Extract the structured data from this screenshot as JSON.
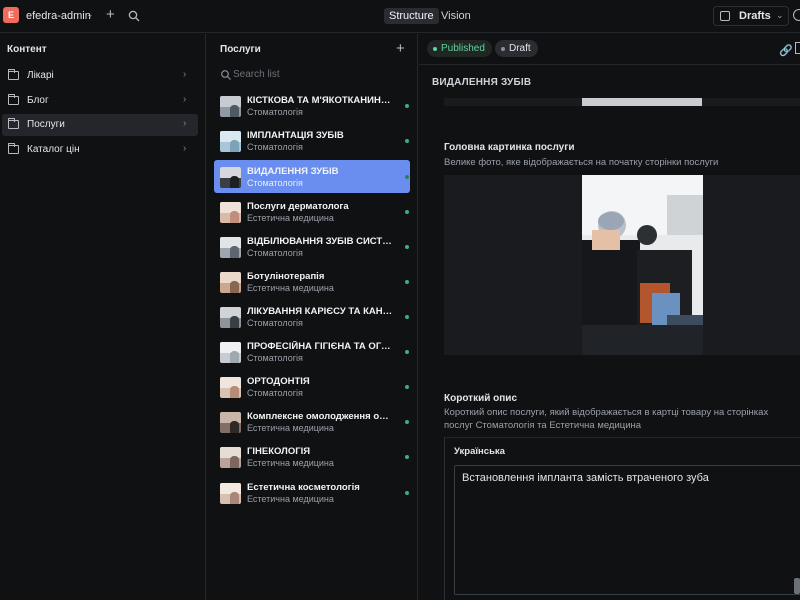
{
  "topbar": {
    "project_initial": "E",
    "project_name": "efedra-admin",
    "tabs": [
      "Structure",
      "Vision"
    ],
    "drafts_label": "Drafts"
  },
  "content_pane": {
    "title": "Контент",
    "items": [
      {
        "label": "Лікарі"
      },
      {
        "label": "Блог"
      },
      {
        "label": "Послуги",
        "selected": true
      },
      {
        "label": "Каталог цін"
      }
    ]
  },
  "list_pane": {
    "title": "Послуги",
    "search_placeholder": "Search list",
    "rows": [
      {
        "title": "КІСТКОВА ТА М'ЯКОТКАНИННА ПЛАСТИКА",
        "subtitle": "Стоматологія"
      },
      {
        "title": "ІМПЛАНТАЦІЯ ЗУБІВ",
        "subtitle": "Стоматологія"
      },
      {
        "title": "ВИДАЛЕННЯ ЗУБІВ",
        "subtitle": "Стоматологія",
        "selected": true
      },
      {
        "title": "Послуги дерматолога",
        "subtitle": "Естетична медицина"
      },
      {
        "title": "ВІДБІЛЮВАННЯ ЗУБІВ СИСТЕМОЮ",
        "subtitle": "Стоматологія"
      },
      {
        "title": "Ботулінотерапія",
        "subtitle": "Естетична медицина"
      },
      {
        "title": "ЛІКУВАННЯ КАРІЄСУ ТА КАНАЛІВ",
        "subtitle": "Стоматологія"
      },
      {
        "title": "ПРОФЕСІЙНА ГІГІЄНА ТА ОГЛЯД",
        "subtitle": "Стоматологія"
      },
      {
        "title": "ОРТОДОНТІЯ",
        "subtitle": "Стоматологія"
      },
      {
        "title": "Комплексне омолодження обличчя",
        "subtitle": "Естетична медицина"
      },
      {
        "title": "ГІНЕКОЛОГІЯ",
        "subtitle": "Естетична медицина"
      },
      {
        "title": "Естетична косметологія",
        "subtitle": "Естетична медицина"
      }
    ]
  },
  "document": {
    "status_published": "Published",
    "status_draft": "Draft",
    "title": "ВИДАЛЕННЯ ЗУБІВ",
    "main_image": {
      "label": "Головна картинка послуги",
      "description": "Велике фото, яке відображається на початку сторінки послуги"
    },
    "short_description": {
      "label": "Короткий опис",
      "description": "Короткий опис послуги, який відображається в картці товару на сторінках послуг Стоматологія та Естетична медицина",
      "language": "Українська",
      "value": "Встановлення імпланта замість втраченого зуба"
    }
  },
  "colors": {
    "accent": "#6a8ef0",
    "published": "#5ed49b",
    "logo": "#f06b5c"
  }
}
